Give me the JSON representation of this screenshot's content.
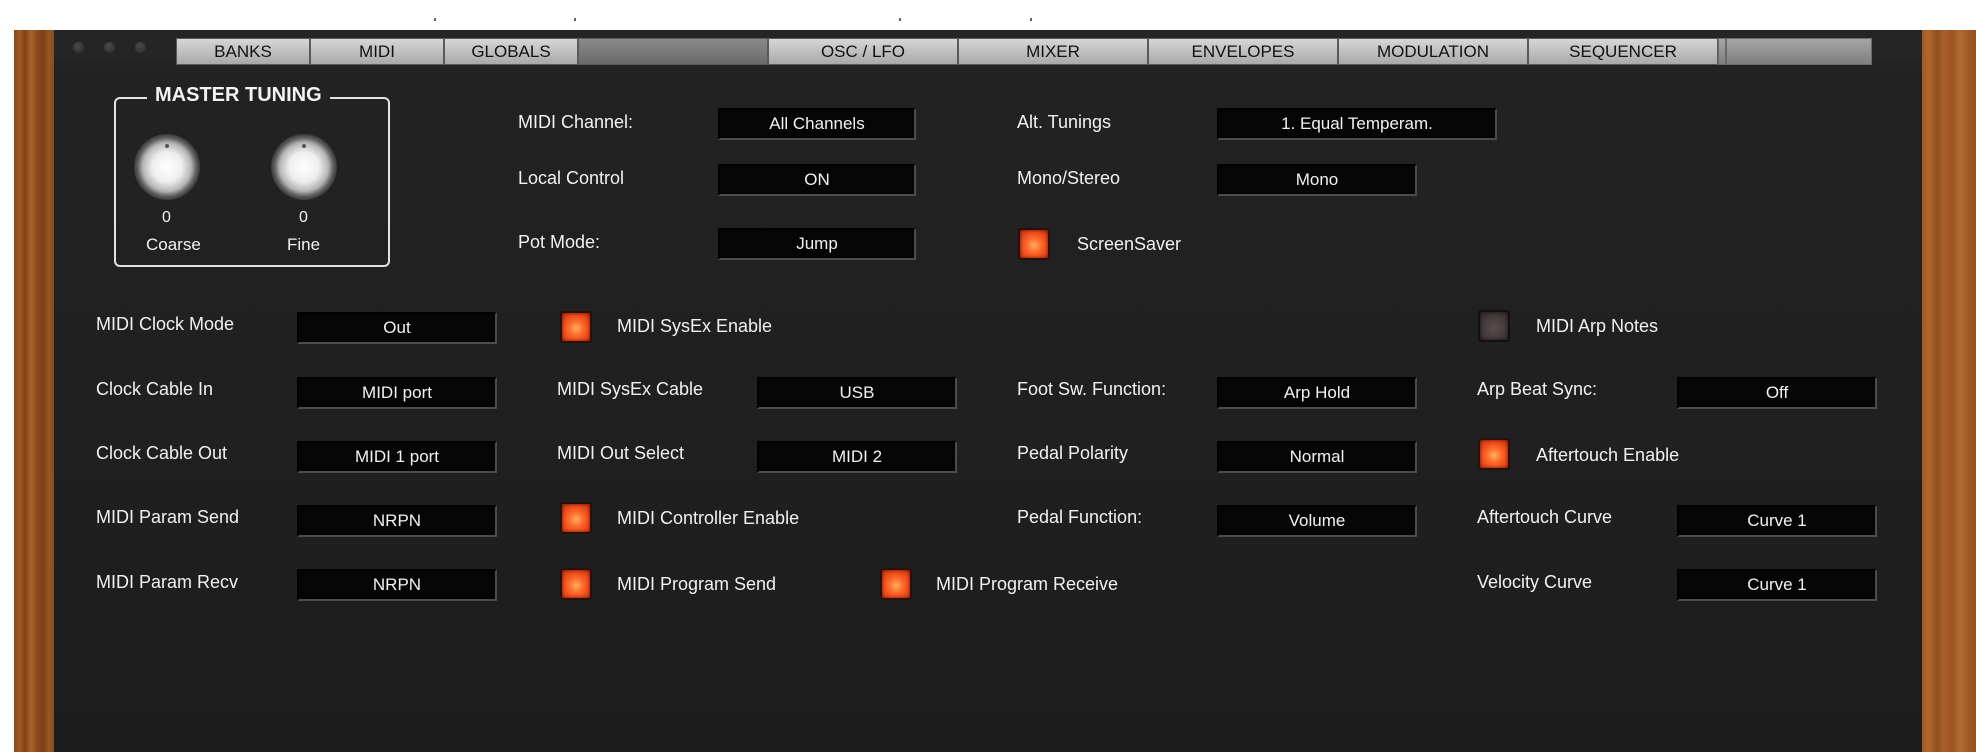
{
  "tabs": [
    "BANKS",
    "MIDI",
    "GLOBALS",
    "OSC / LFO",
    "MIXER",
    "ENVELOPES",
    "MODULATION",
    "SEQUENCER"
  ],
  "master_tuning": {
    "title": "MASTER TUNING",
    "coarse": {
      "value": "0",
      "label": "Coarse"
    },
    "fine": {
      "value": "0",
      "label": "Fine"
    }
  },
  "top": {
    "midi_channel": {
      "label": "MIDI Channel:",
      "value": "All Channels"
    },
    "local_control": {
      "label": "Local Control",
      "value": "ON"
    },
    "pot_mode": {
      "label": "Pot Mode:",
      "value": "Jump"
    },
    "alt_tunings": {
      "label": "Alt. Tunings",
      "value": "1. Equal Temperam."
    },
    "mono_stereo": {
      "label": "Mono/Stereo",
      "value": "Mono"
    },
    "screensaver": {
      "label": "ScreenSaver",
      "on": true
    }
  },
  "col1": {
    "clock_mode": {
      "label": "MIDI Clock Mode",
      "value": "Out"
    },
    "clock_cable_in": {
      "label": "Clock Cable In",
      "value": "MIDI port"
    },
    "clock_cable_out": {
      "label": "Clock Cable Out",
      "value": "MIDI 1 port"
    },
    "param_send": {
      "label": "MIDI Param Send",
      "value": "NRPN"
    },
    "param_recv": {
      "label": "MIDI Param Recv",
      "value": "NRPN"
    }
  },
  "col2": {
    "sysex_enable": {
      "label": "MIDI SysEx Enable",
      "on": true
    },
    "sysex_cable": {
      "label": "MIDI SysEx Cable",
      "value": "USB"
    },
    "out_select": {
      "label": "MIDI Out Select",
      "value": "MIDI 2"
    },
    "controller_enable": {
      "label": "MIDI Controller Enable",
      "on": true
    },
    "program_send": {
      "label": "MIDI Program Send",
      "on": true
    },
    "program_receive": {
      "label": "MIDI Program Receive",
      "on": true
    }
  },
  "col3": {
    "foot_sw": {
      "label": "Foot Sw. Function:",
      "value": "Arp Hold"
    },
    "pedal_polarity": {
      "label": "Pedal Polarity",
      "value": "Normal"
    },
    "pedal_function": {
      "label": "Pedal Function:",
      "value": "Volume"
    }
  },
  "col4": {
    "arp_notes": {
      "label": "MIDI Arp Notes",
      "on": false
    },
    "arp_beat_sync": {
      "label": "Arp Beat Sync:",
      "value": "Off"
    },
    "aftertouch_enable": {
      "label": "Aftertouch Enable",
      "on": true
    },
    "aftertouch_curve": {
      "label": "Aftertouch Curve",
      "value": "Curve 1"
    },
    "velocity_curve": {
      "label": "Velocity Curve",
      "value": "Curve 1"
    }
  },
  "colors": {
    "panel": "#222222",
    "led_on": "#ff6a2a",
    "wood": "#8a4a1c"
  }
}
